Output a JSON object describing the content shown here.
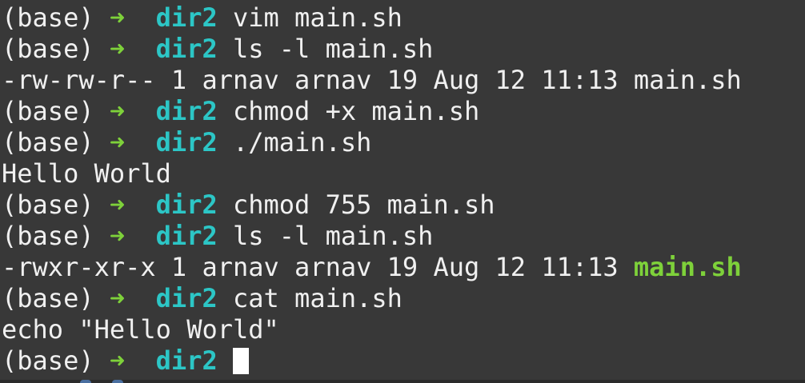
{
  "terminal": {
    "background": "#383838",
    "colors": {
      "prompt_arrow": "#7ed13a",
      "directory": "#2cc6c6",
      "executable": "#7ed13a",
      "text": "#f0f0f0"
    },
    "prompt": {
      "env": "(base)",
      "arrow": "➜",
      "dir": "dir2"
    },
    "lines": [
      {
        "type": "cmd",
        "text": "vim main.sh"
      },
      {
        "type": "cmd",
        "text": "ls -l main.sh"
      },
      {
        "type": "out",
        "text": "-rw-rw-r-- 1 arnav arnav 19 Aug 12 11:13 main.sh"
      },
      {
        "type": "cmd",
        "text": "chmod +x main.sh"
      },
      {
        "type": "cmd",
        "text": "./main.sh"
      },
      {
        "type": "out",
        "text": "Hello World"
      },
      {
        "type": "cmd",
        "text": "chmod 755 main.sh"
      },
      {
        "type": "cmd",
        "text": "ls -l main.sh"
      },
      {
        "type": "out_exec",
        "text": "-rwxr-xr-x 1 arnav arnav 19 Aug 12 11:13 ",
        "highlight": "main.sh"
      },
      {
        "type": "cmd",
        "text": "cat main.sh"
      },
      {
        "type": "out",
        "text": "echo \"Hello World\""
      },
      {
        "type": "input",
        "text": ""
      }
    ]
  }
}
